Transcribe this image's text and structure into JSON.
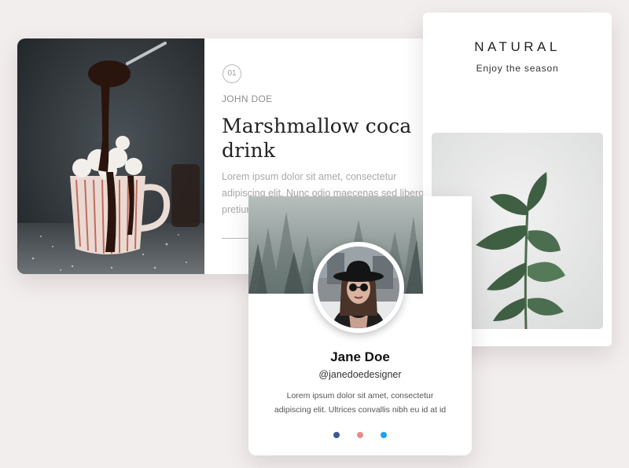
{
  "recipe_card": {
    "number": "01",
    "author": "JOHN DOE",
    "title_line1": "Marshmallow coca",
    "title_line2": "drink",
    "desc_line1": "Lorem ipsum dolor sit amet, consectetur",
    "desc_line2": "adipiscing elit. Nunc odio maecenas sed libero",
    "desc_line3": "pretium"
  },
  "natural_card": {
    "heading": "NATURAL",
    "subheading": "Enjoy the season"
  },
  "profile_card": {
    "name": "Jane Doe",
    "handle": "@janedoedesigner",
    "bio_line1": "Lorem ipsum dolor sit amet, consectetur",
    "bio_line2": "adipiscing elit. Ultrices convallis nibh eu id at id",
    "socials": [
      "facebook-icon",
      "dribbble-icon",
      "twitter-icon"
    ]
  },
  "colors": {
    "background": "#f3eeee",
    "facebook": "#3b5998",
    "dribbble": "#ea8a8a",
    "twitter": "#1da1f2"
  }
}
